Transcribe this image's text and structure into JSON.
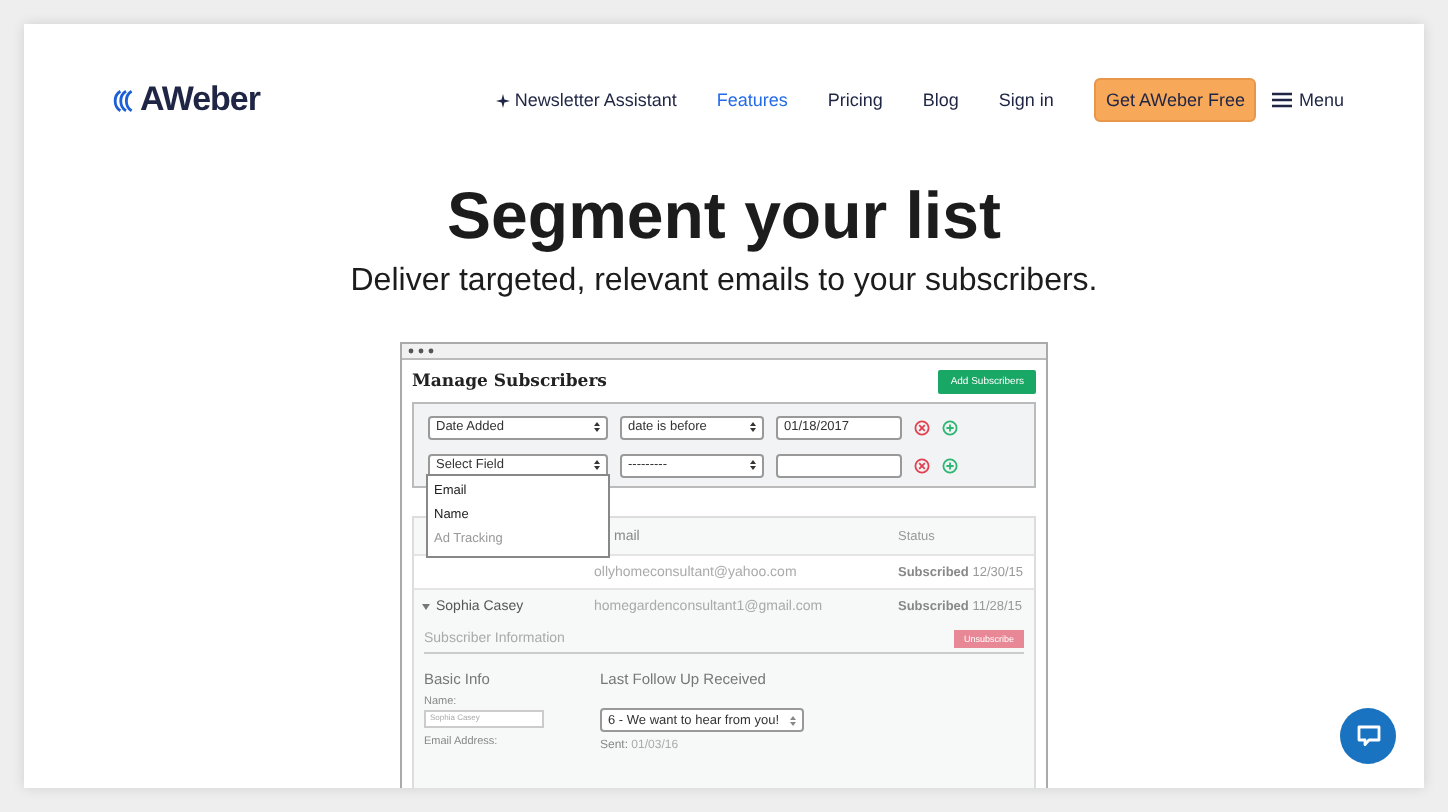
{
  "header": {
    "logo": "AWeber",
    "nav": [
      {
        "label": "Newsletter Assistant",
        "kind": "sparkle",
        "selected": false
      },
      {
        "label": "Features",
        "kind": "link",
        "selected": true
      },
      {
        "label": "Pricing",
        "kind": "link",
        "selected": false
      },
      {
        "label": "Blog",
        "kind": "link",
        "selected": false
      },
      {
        "label": "Sign in",
        "kind": "link",
        "selected": false
      }
    ],
    "cta": "Get AWeber Free",
    "menu": "Menu"
  },
  "hero": {
    "title": "Segment your list",
    "subtitle": "Deliver targeted, relevant emails to your subscribers."
  },
  "mockup": {
    "title": "Manage Subscribers",
    "add_button": "Add Subscribers",
    "filters": [
      {
        "field": "Date Added",
        "operator": "date is before",
        "value": "01/18/2017"
      },
      {
        "field": "Select Field",
        "operator": "---------"
      }
    ],
    "dropdown": [
      {
        "label": "Email",
        "disabled": false
      },
      {
        "label": "Name",
        "disabled": false
      },
      {
        "label": "Ad Tracking",
        "disabled": true
      }
    ],
    "columns": [
      "mail",
      "Status"
    ],
    "rows": [
      {
        "email": "ollyhomeconsultant@yahoo.com",
        "status": "Subscribed",
        "date": "12/30/15"
      },
      {
        "name": "Sophia Casey",
        "email": "homegardenconsultant1@gmail.com",
        "status": "Subscribed",
        "date": "11/28/15"
      }
    ],
    "detail": {
      "heading": "Subscriber Information",
      "unsubscribe": "Unsubscribe",
      "basic": "Basic Info",
      "name_label": "Name:",
      "name_value": "Sophia Casey",
      "email_label": "Email Address:",
      "follow_heading": "Last Follow Up Received",
      "follow_value": "6 - We want to hear from you!",
      "sent_label": "Sent:",
      "sent_value": "01/03/16"
    }
  }
}
